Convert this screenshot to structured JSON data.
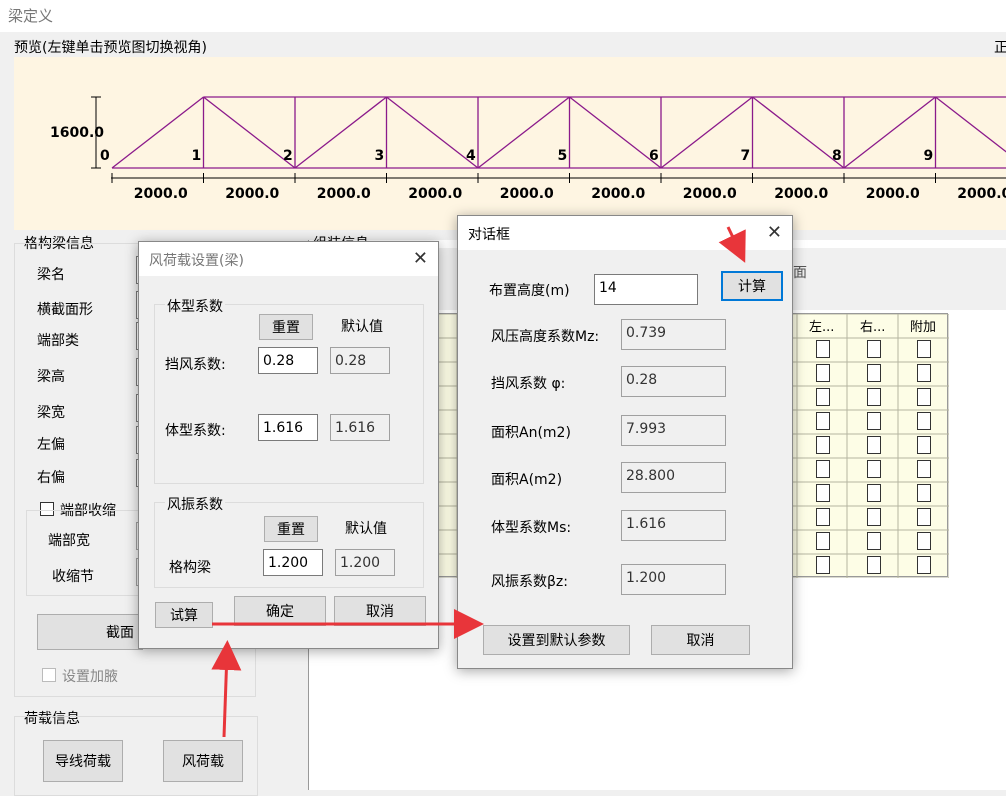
{
  "window": {
    "title": "梁定义"
  },
  "preview": {
    "label": "预览(左键单击预览图切换视角)",
    "label_right": "正",
    "height_label": "1600.0",
    "node_labels": [
      "0",
      "1",
      "2",
      "3",
      "4",
      "5",
      "6",
      "7",
      "8",
      "9"
    ],
    "span_labels": [
      "2000.0",
      "2000.0",
      "2000.0",
      "2000.0",
      "2000.0",
      "2000.0",
      "2000.0",
      "2000.0",
      "2000.0",
      "2000.0"
    ]
  },
  "beam_info": {
    "group_label": "格构梁信息",
    "fields": [
      "梁名",
      "横截面形",
      "端部类",
      "梁高",
      "梁宽",
      "左偏",
      "右偏"
    ],
    "end_shrink_label": "端部收缩",
    "end_width_label": "端部宽",
    "shrink_node_label": "收缩节",
    "section_button": "截面",
    "add_haunch_label": "设置加腋"
  },
  "load_info": {
    "group_label": "荷载信息",
    "wire_load_button": "导线荷载",
    "wind_load_button": "风荷载"
  },
  "bg_panel": {
    "partial_label": "组装信息",
    "partial_label2": "面",
    "table_headers": [
      "左...",
      "右...",
      "附加"
    ]
  },
  "wind_dialog": {
    "title": "风荷载设置(梁)",
    "shape_group": "体型系数",
    "reset_label": "重置",
    "default_label": "默认值",
    "wind_block_label": "挡风系数:",
    "wind_block_value": "0.28",
    "wind_block_default": "0.28",
    "shape_coef_label": "体型系数:",
    "shape_coef_value": "1.616",
    "shape_coef_default": "1.616",
    "vibration_group": "风振系数",
    "reset_label2": "重置",
    "default_label2": "默认值",
    "lattice_label": "格构梁",
    "lattice_value": "1.200",
    "lattice_default": "1.200",
    "trial_button": "试算",
    "ok_button": "确定",
    "cancel_button": "取消"
  },
  "calc_dialog": {
    "title": "对话框",
    "height_label": "布置高度(m)",
    "height_value": "14",
    "calc_button": "计算",
    "rows": [
      {
        "label": "风压高度系数Mz:",
        "value": "0.739"
      },
      {
        "label": "挡风系数 φ:",
        "value": "0.28"
      },
      {
        "label": "面积An(m2)",
        "value": "7.993"
      },
      {
        "label": "面积A(m2)",
        "value": "28.800"
      },
      {
        "label": "体型系数Ms:",
        "value": "1.616"
      },
      {
        "label": "风振系数βz:",
        "value": "1.200"
      }
    ],
    "set_default_button": "设置到默认参数",
    "cancel_button": "取消"
  },
  "colors": {
    "truss": "#8b1a8b",
    "annotation_arrow": "#e8353a",
    "preview_bg": "#fef5e2"
  }
}
